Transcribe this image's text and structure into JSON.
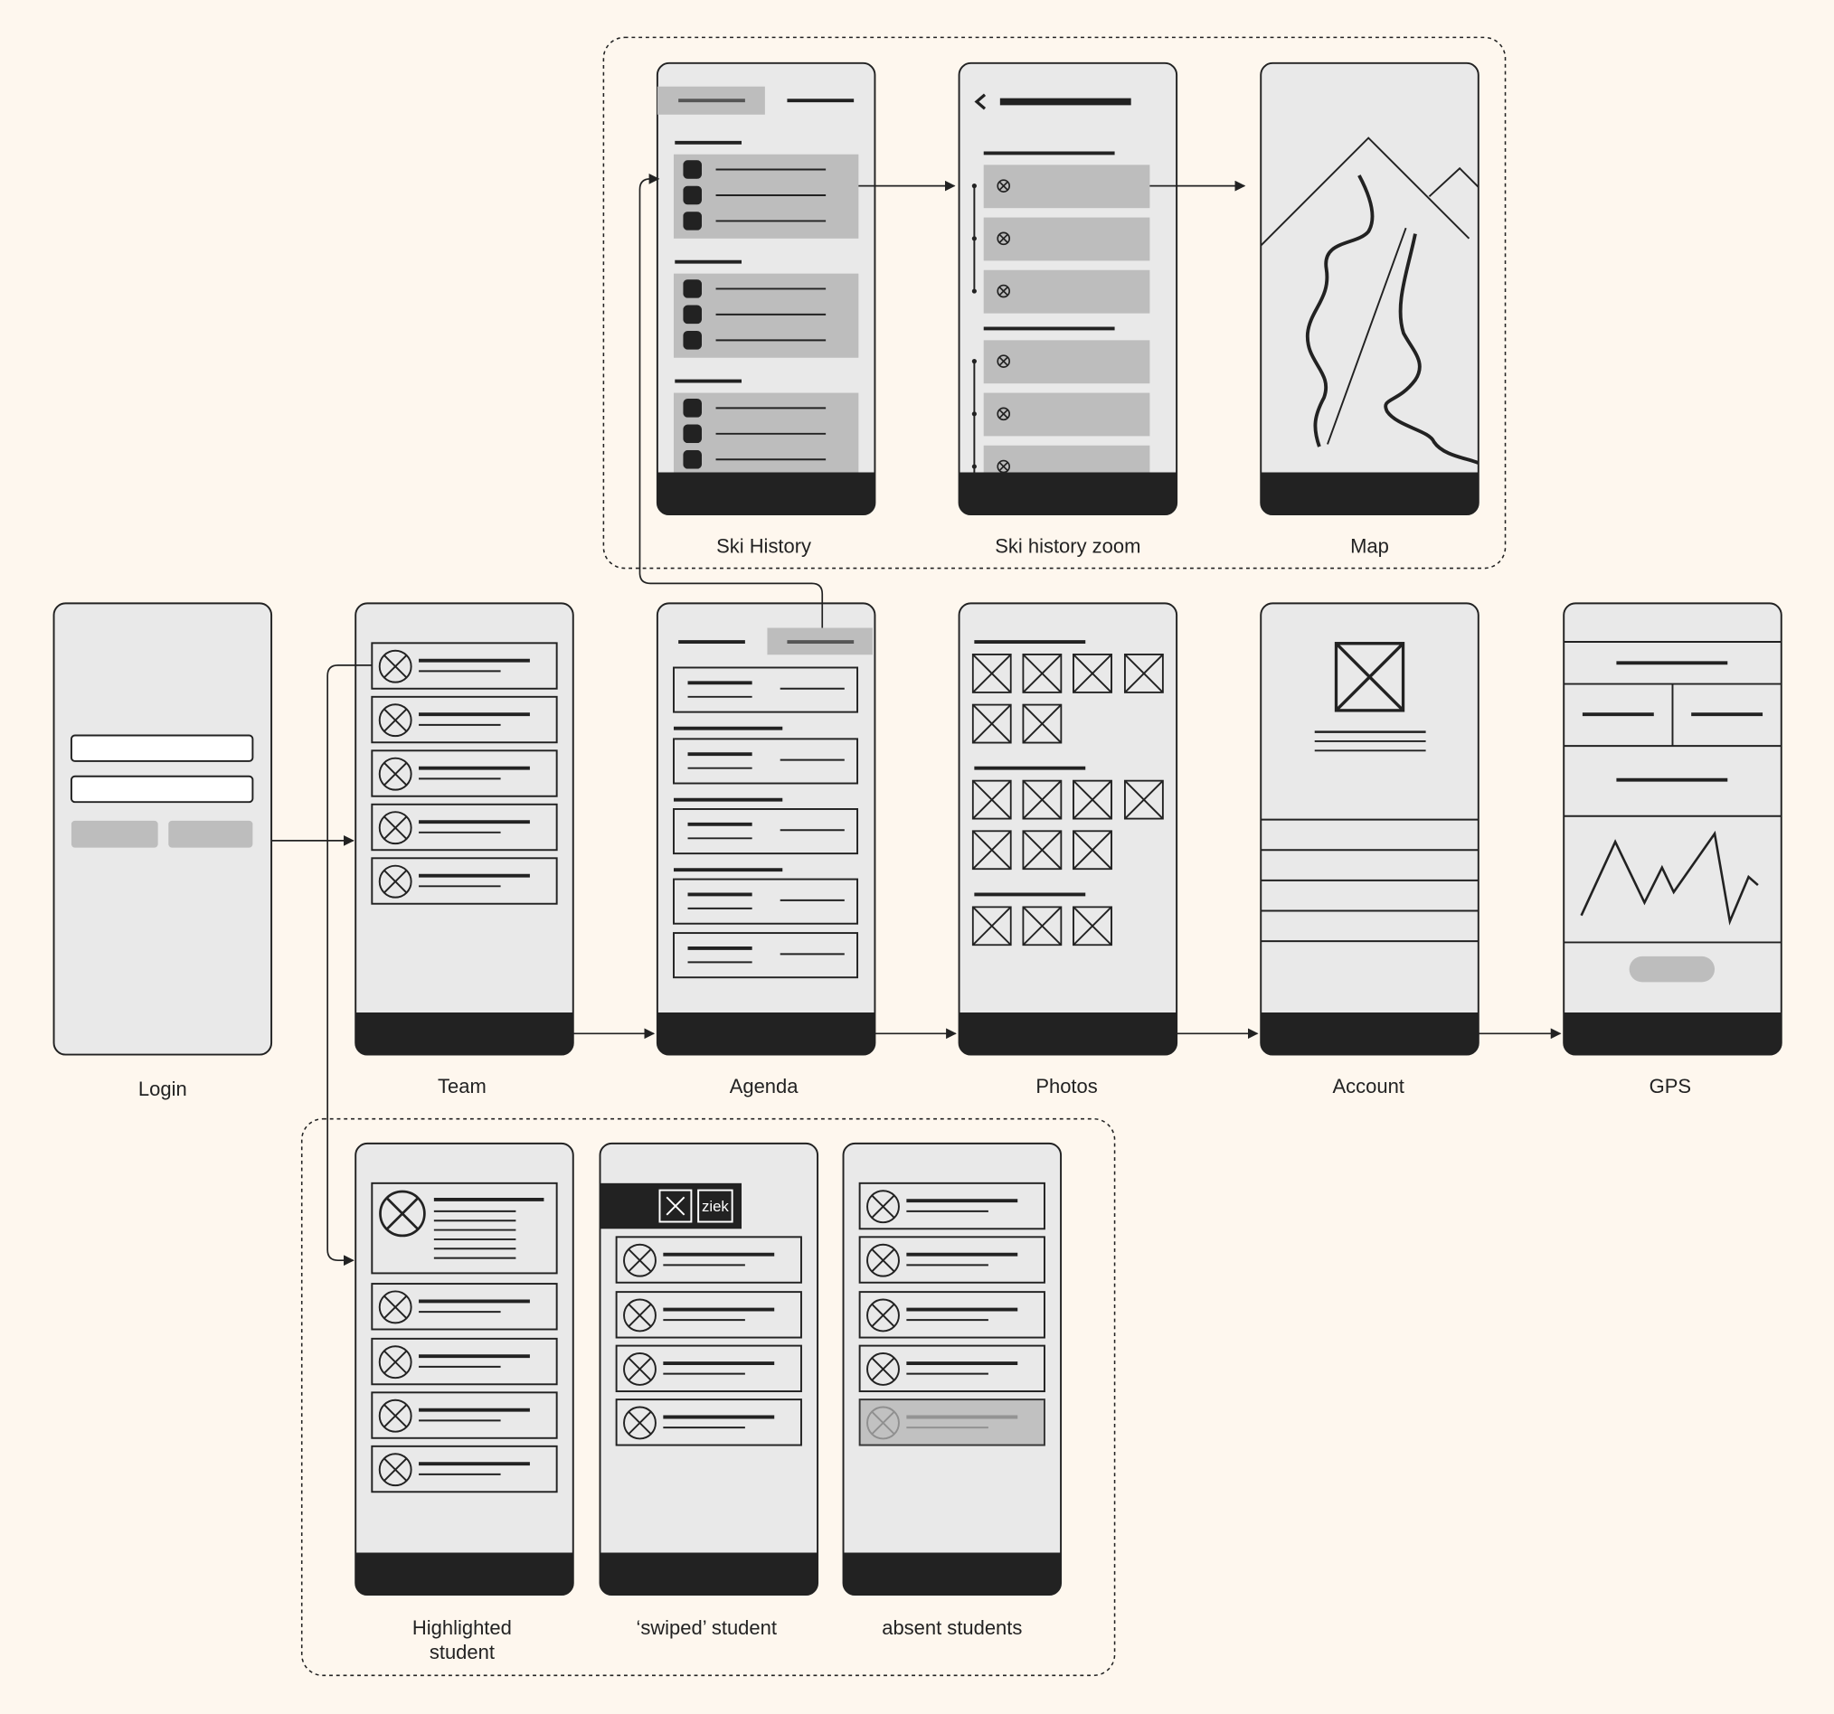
{
  "screens": {
    "ski_history": "Ski History",
    "ski_history_zoom": "Ski history zoom",
    "map": "Map",
    "login": "Login",
    "team": "Team",
    "agenda": "Agenda",
    "photos": "Photos",
    "account": "Account",
    "gps": "GPS",
    "highlighted_line1": "Highlighted",
    "highlighted_line2": "student",
    "swiped": "‘swiped’ student",
    "absent": "absent students"
  },
  "swipe_action_label": "ziek",
  "colors": {
    "background": "#fef7ee",
    "screen_fill": "#e9e9e9",
    "block_fill": "#bdbdbd",
    "ink": "#222222"
  }
}
